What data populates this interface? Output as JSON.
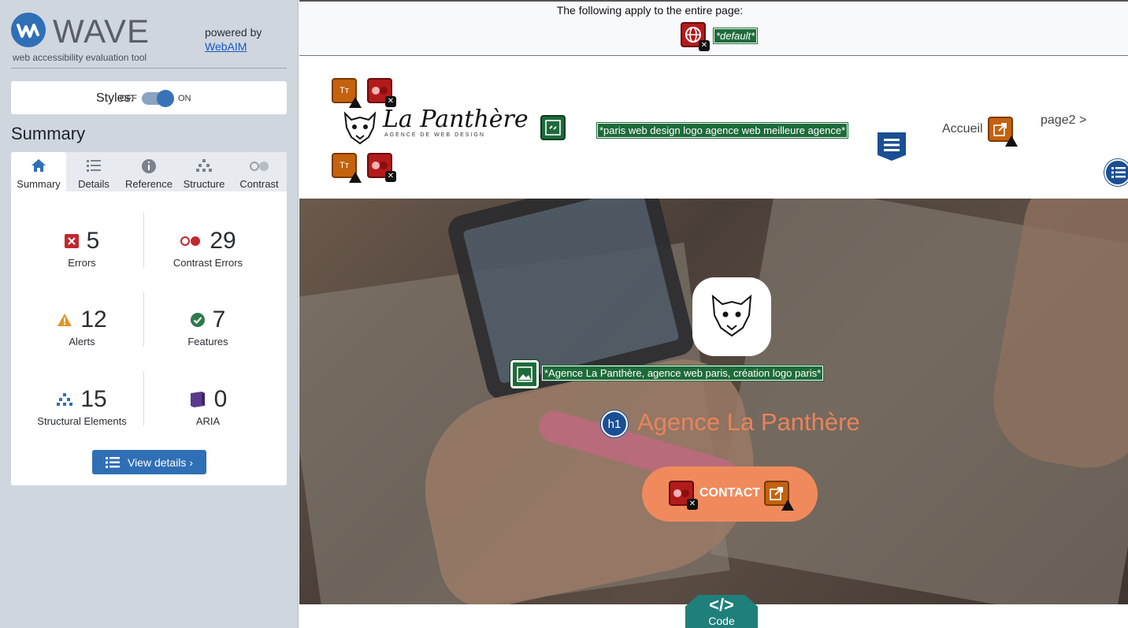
{
  "wave": {
    "logo_word": "WAVE",
    "logo_sub": "web accessibility evaluation tool",
    "powered_by": "powered by",
    "webaim": "WebAIM"
  },
  "styles": {
    "label": "Styles:",
    "off": "OFF",
    "on": "ON",
    "state": "on"
  },
  "summary_title": "Summary",
  "tabs": [
    {
      "label": "Summary",
      "icon": "home-icon",
      "active": true
    },
    {
      "label": "Details",
      "icon": "list-icon"
    },
    {
      "label": "Reference",
      "icon": "info-icon"
    },
    {
      "label": "Structure",
      "icon": "structure-icon"
    },
    {
      "label": "Contrast",
      "icon": "contrast-icon"
    }
  ],
  "stats": {
    "errors": {
      "value": "5",
      "label": "Errors",
      "color": "#c0282d"
    },
    "contrast": {
      "value": "29",
      "label": "Contrast Errors",
      "color": "#c0282d"
    },
    "alerts": {
      "value": "12",
      "label": "Alerts",
      "color": "#e0952a"
    },
    "features": {
      "value": "7",
      "label": "Features",
      "color": "#2f7a4b"
    },
    "structural": {
      "value": "15",
      "label": "Structural Elements",
      "color": "#2f6fb6"
    },
    "aria": {
      "value": "0",
      "label": "ARIA",
      "color": "#5a3a8e"
    }
  },
  "view_details": "View details ›",
  "page": {
    "banner": "The following apply to the entire page:",
    "lang_tag": "*default*",
    "logo_text": "La Panthère",
    "logo_sub": "AGENCE DE WEB DESIGN",
    "logo_alt": "*paris web design logo agence web meilleure agence*",
    "nav_accueil": "Accueil",
    "nav_page2": "page2 >",
    "hero_alt": "*Agence La Panthère, agence web paris, création logo paris*",
    "h1_badge": "h1",
    "hero_title": "Agence La Panthère",
    "contact": "CONTACT"
  },
  "code_tab": {
    "glyph": "</>",
    "label": "Code"
  }
}
